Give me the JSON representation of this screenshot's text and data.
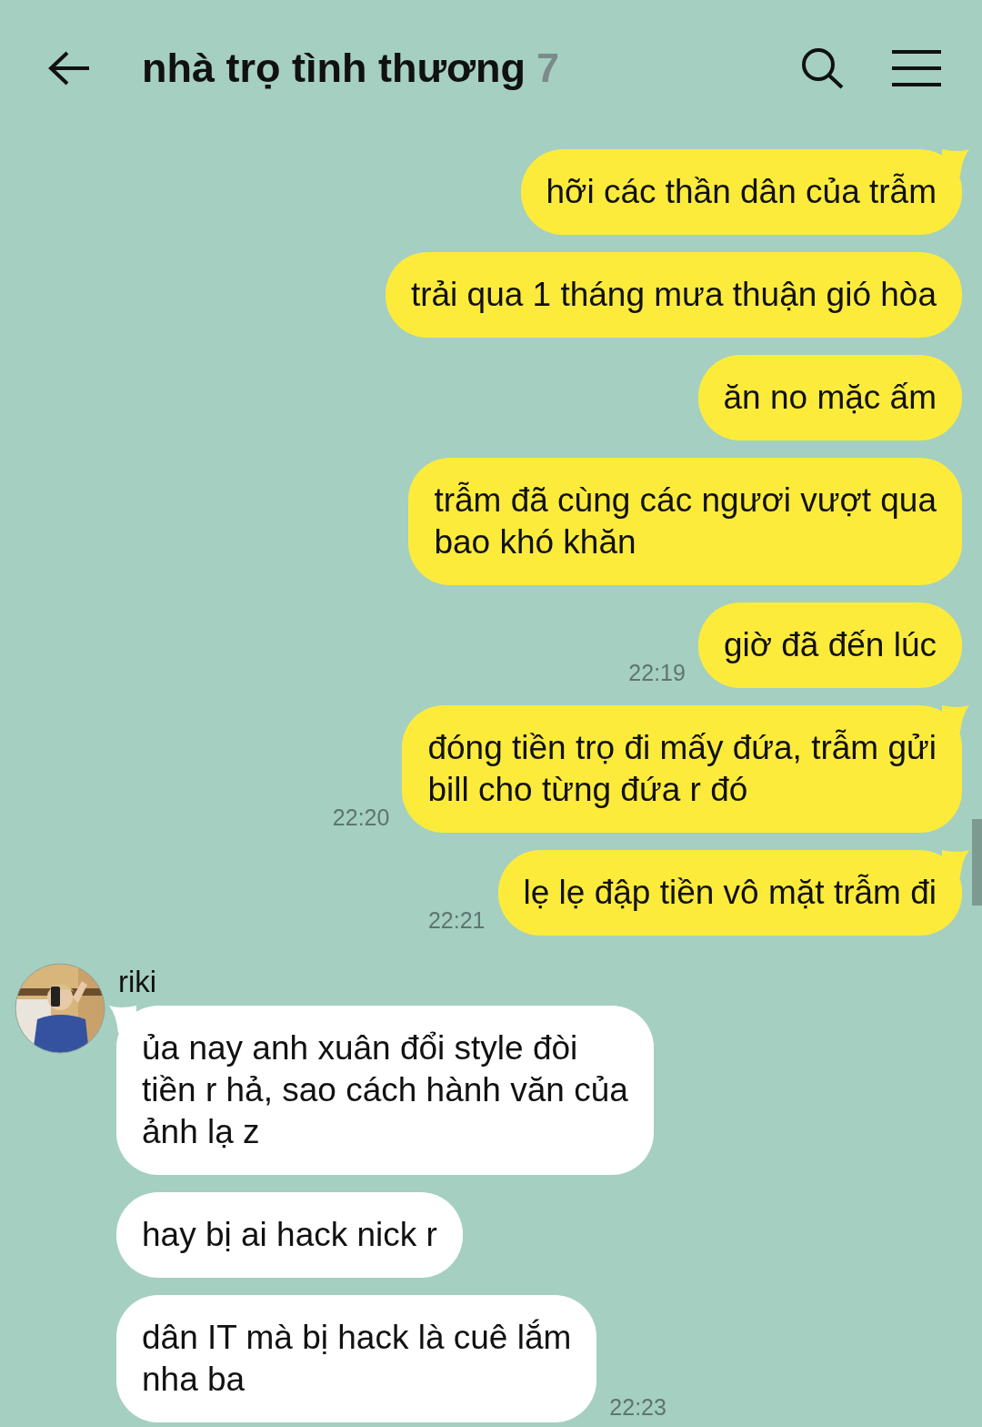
{
  "header": {
    "title": "nhà trọ tình thương",
    "member_count": "7"
  },
  "messages": [
    {
      "kind": "outgoing",
      "text": "hỡi các thần dân của trẫm",
      "tail": true
    },
    {
      "kind": "outgoing",
      "text": "trải qua 1 tháng mưa thuận gió hòa",
      "tail": false
    },
    {
      "kind": "outgoing",
      "text": "ăn no mặc ấm",
      "tail": false
    },
    {
      "kind": "outgoing",
      "text": "trẫm đã cùng các ngươi vượt qua\nbao khó khăn",
      "tail": false
    },
    {
      "kind": "outgoing",
      "text": "giờ đã đến lúc",
      "time": "22:19",
      "tail": false
    },
    {
      "kind": "outgoing",
      "text": "đóng tiền trọ đi mấy đứa, trẫm gửi\nbill cho từng đứa r đó",
      "time": "22:20",
      "tail": true
    },
    {
      "kind": "outgoing",
      "text": "lẹ lẹ đập tiền vô mặt trẫm đi",
      "time": "22:21",
      "tail": true
    },
    {
      "kind": "incoming",
      "sender": "riki",
      "text": "ủa nay anh xuân đổi style đòi\ntiền r hả, sao cách hành văn của\nảnh lạ z",
      "tail": true
    },
    {
      "kind": "incoming",
      "text": "hay bị ai hack nick r",
      "tail": false
    },
    {
      "kind": "incoming",
      "text": "dân IT mà bị hack là cuê lắm\nnha ba",
      "time": "22:23",
      "tail": false
    }
  ]
}
